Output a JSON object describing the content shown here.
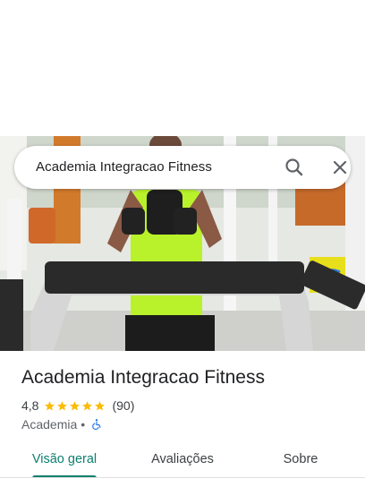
{
  "place": {
    "name": "Academia Integracao Fitness",
    "rating": "4,8",
    "stars_filled": 5,
    "review_count": "(90)",
    "category": "Academia",
    "separator": "•",
    "accessibility_icon": "wheelchair-icon"
  },
  "search": {
    "query": "Academia Integracao Fitness",
    "search_icon": "search-icon",
    "close_icon": "close-icon"
  },
  "tabs": [
    {
      "label": "Visão geral",
      "active": true
    },
    {
      "label": "Avaliações",
      "active": false
    },
    {
      "label": "Sobre",
      "active": false
    }
  ],
  "colors": {
    "accent": "#0b7f6f",
    "star": "#fbbc04",
    "accessibility": "#1a73e8"
  }
}
